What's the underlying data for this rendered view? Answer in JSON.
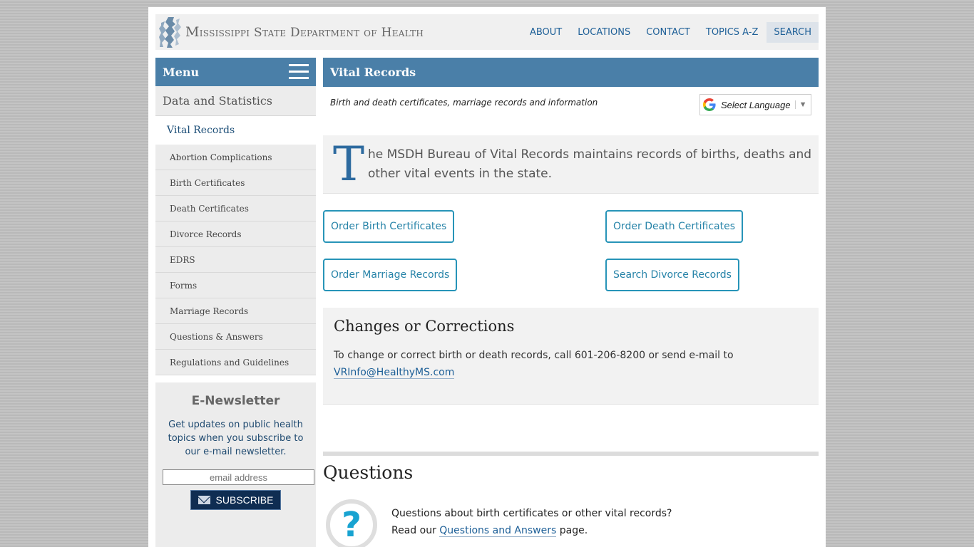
{
  "header": {
    "site_title_big1": "M",
    "site_title": "ississippi State Department of Health",
    "site_title_full": "Mississippi State Department of Health",
    "nav": [
      "ABOUT",
      "LOCATIONS",
      "CONTACT",
      "TOPICS A-Z",
      "SEARCH"
    ]
  },
  "sidebar": {
    "menu_label": "Menu",
    "section": "Data and Statistics",
    "current": "Vital Records",
    "items": [
      "Abortion Complications",
      "Birth Certificates",
      "Death Certificates",
      "Divorce Records",
      "EDRS",
      "Forms",
      "Marriage Records",
      "Questions & Answers",
      "Regulations and Guidelines"
    ],
    "newsletter": {
      "title": "E-Newsletter",
      "text": "Get updates on public health topics when you subscribe to our e-mail newsletter.",
      "placeholder": "email address",
      "button": "SUBSCRIBE"
    }
  },
  "main": {
    "title": "Vital Records",
    "subtitle": "Birth and death certificates, marriage records and information",
    "language": "Select Language",
    "intro_dropcap": "T",
    "intro": "he MSDH Bureau of Vital Records maintains records of births, deaths and other vital events in the state.",
    "buttons": [
      "Order Birth Certificates",
      "Order Death Certificates",
      "Order Marriage Records",
      "Search Divorce Records"
    ],
    "changes": {
      "title": "Changes or Corrections",
      "text": "To change or correct birth or death records, call 601-206-8200 or send e-mail to",
      "email": "VRInfo@HealthyMS.com"
    },
    "questions": {
      "title": "Questions",
      "line1": "Questions about birth certificates or other vital records?",
      "line2_pre": "Read our",
      "link": "Questions and Answers",
      "line2_post": "page."
    }
  },
  "colors": {
    "brand_blue": "#4a7fa8",
    "link_blue": "#1d5f97",
    "button_teal": "#2794b8",
    "subscribe_navy": "#0f2d52"
  }
}
